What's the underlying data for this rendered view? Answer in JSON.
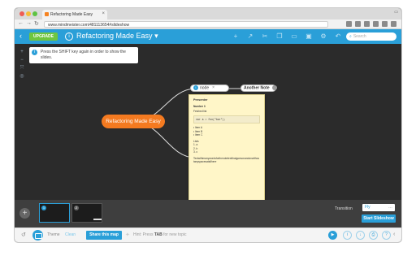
{
  "browser": {
    "tab_title": "Refactoring Made Easy",
    "url": "www.mindmeister.com/481113654#slideshow"
  },
  "app": {
    "upgrade_label": "UPGRADE",
    "map_title": "Refactoring Made Easy",
    "search_placeholder": "Search",
    "brand_color": "#2a9fd8",
    "accent_color": "#f47a20"
  },
  "canvas": {
    "hint": "Press the SHIFT key again in order to show the slides.",
    "root_node": "Refactoring Made Easy",
    "node_pill": "node",
    "another_note": "Another Note"
  },
  "note": {
    "title": "Presenter",
    "subtitle": "Number 3",
    "lines": [
      "Fetched list",
      "var a = foo(\"bar\");",
      "• Item A",
      "• Item B",
      "• Item C",
      "Lists",
      "1. a",
      "2. b",
      "3. c",
      "Textwithmanywordsforthenotetextthatgoesonandonwithoutanyspacesatallhere"
    ]
  },
  "slides": {
    "add_label": "+",
    "thumb1_num": "1",
    "thumb2_num": "2",
    "transition_label": "Transition",
    "transition_value": "Fly",
    "start_label": "Start Slideshow"
  },
  "bottom": {
    "theme_label": "Theme",
    "theme_value": "Clean",
    "share_label": "Share this map",
    "hint_prefix": "Hint: Press",
    "hint_key": "TAB",
    "hint_suffix": "for new topic"
  }
}
